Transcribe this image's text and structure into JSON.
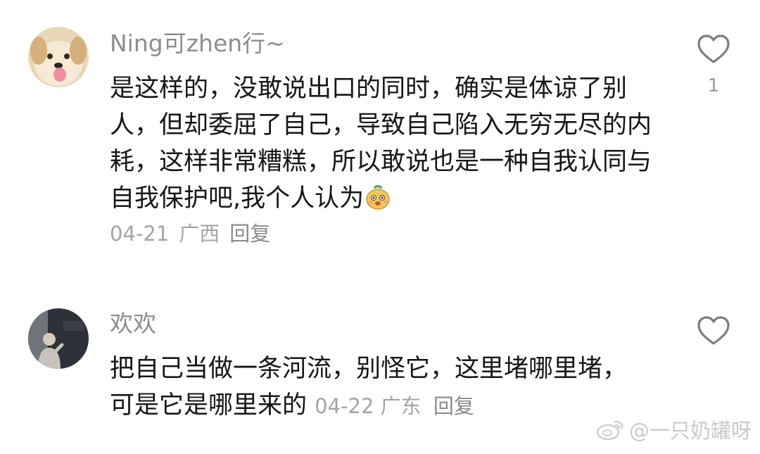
{
  "comments": [
    {
      "username": "Ning可zhen行~",
      "content": "是这样的，没敢说出口的同时，确实是体谅了别人，但却委屈了自己，导致自己陷入无穷无尽的内耗，这样非常糟糕，所以敢说也是一种自我认同与自我保护吧,我个人认为",
      "emoji": "pear-face-emoji",
      "date": "04-21",
      "location": "广西",
      "reply_label": "回复",
      "like_count": "1",
      "like_icon": "heart-outline-icon"
    },
    {
      "username": "欢欢",
      "content": "把自己当做一条河流，别怪它，这里堵哪里堵，可是它是哪里来的",
      "date": "04-22",
      "location": "广东",
      "reply_label": "回复",
      "like_icon": "heart-outline-icon"
    }
  ],
  "watermark": {
    "icon": "weibo-logo-icon",
    "text": "@一只奶罐呀"
  }
}
